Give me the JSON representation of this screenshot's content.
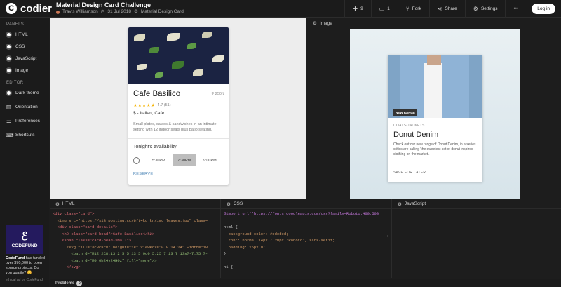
{
  "app": {
    "name": "codier",
    "logo_letter": "C"
  },
  "header": {
    "title": "Material Design Card Challenge",
    "author": "Travis Williamson",
    "date": "31 Jul 2018",
    "tag": "Material Design Card"
  },
  "actions": {
    "likes": "9",
    "comments": "1",
    "fork": "Fork",
    "share": "Share",
    "settings": "Settings",
    "more": "•••",
    "login": "Log in"
  },
  "sidebar": {
    "panels_heading": "PANELS",
    "panels": [
      "HTML",
      "CSS",
      "JavaScript",
      "Image"
    ],
    "editor_heading": "EDITOR",
    "editor_items": [
      "Dark theme",
      "Orientation",
      "Preferences",
      "Shortcuts"
    ]
  },
  "ad": {
    "name": "CODEFUND",
    "text_bold": "CodeFund",
    "text": "has funded over $70,000 to open source projects. Do you qualify? 😊",
    "footer": "ethical ad by CodeFund"
  },
  "preview_card": {
    "title": "Cafe Basilico",
    "distance": "250ft",
    "stars": "★★★★★",
    "rating": "4.7 (51)",
    "price": "$ - Italian, Cafe",
    "description": "Small plates, salads & sandwiches in an intimate setting with 12 indoor seats plus patio seating.",
    "availability": "Tonight's availability",
    "times": [
      "5:30PM",
      "7:30PM",
      "9:00PM"
    ],
    "selected_time": "7:30PM",
    "reserve": "RESERVE"
  },
  "image_panel": {
    "label": "Image",
    "badge": "NEW RANGE",
    "category": "COATS/JACKETS",
    "title": "Donut Denim",
    "description": "Check out our new range of Donut Denim, in a series critics are calling 'the sweetest set of donut inspired clothing on the market'.",
    "save": "SAVE FOR LATER"
  },
  "editors": {
    "html_label": "HTML",
    "css_label": "CSS",
    "js_label": "JavaScript",
    "html_lines": [
      "<div class=\"card\">",
      "  <img src=\"https://s13.postimg.cc/6ft4kgjkn/img_leaves.jpg\" class=",
      "  <div class=\"card-details\">",
      "    <h2 class=\"card-head\">Cafe Basilico</h2>",
      "    <span class=\"card-head-small\">",
      "      <svg fill=\"#c8c8c8\" height=\"18\" viewBox=\"0 0 24 24\" width=\"18",
      "        <path d=\"M12 2C8.13 2 5 5.13 5 9c0 5.25 7 13 7 13s7-7.75 7-",
      "        <path d=\"M0 0h24v24H0z\" fill=\"none\"/>",
      "      </svg>"
    ],
    "css_lines": [
      "@import url('https://fonts.googleapis.com/css?family=Roboto:400,500",
      "",
      "html {",
      "  background-color: #ededed;",
      "  font: normal 14px / 20px 'Roboto', sans-serif;",
      "  padding: 25px 0;",
      "}",
      "",
      "h1 {"
    ]
  },
  "problems": {
    "label": "Problems",
    "count": "0"
  }
}
